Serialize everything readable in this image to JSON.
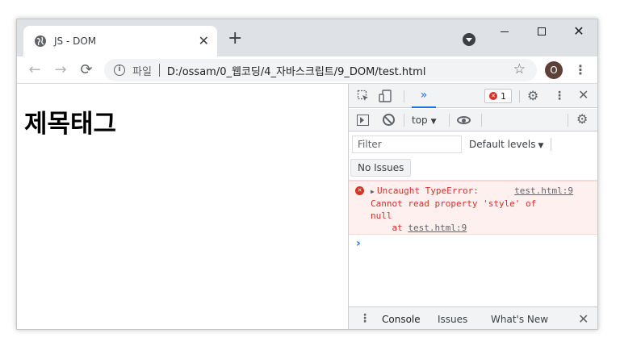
{
  "browser": {
    "tab_title": "JS - DOM",
    "tab_close": "✕",
    "new_tab": "+",
    "window_controls": {
      "close": "✕"
    },
    "nav": {
      "back": "←",
      "forward": "→",
      "reload": "⟳"
    },
    "address": {
      "info_glyph": "i",
      "scheme_label": "파일",
      "url": "D:/ossam/0_웹코딩/4_자바스크립트/9_DOM/test.html",
      "star": "☆"
    },
    "profile_initial": "O",
    "menu": "⋮"
  },
  "page": {
    "heading": "제목태그"
  },
  "devtools": {
    "top": {
      "more_tabs": "»",
      "error_count": "1",
      "error_glyph": "✕",
      "gear": "⚙",
      "kebab": "⋮",
      "close": "✕"
    },
    "console_bar": {
      "context": "top",
      "context_arrow": "▼",
      "gear": "⚙"
    },
    "filter": {
      "placeholder": "Filter",
      "levels": "Default levels",
      "levels_arrow": "▼"
    },
    "issues_button": "No Issues",
    "messages": [
      {
        "level": "error",
        "icon": "✕",
        "expander": "▶",
        "head": "Uncaught TypeError:",
        "source": "test.html:9",
        "line2": "Cannot read property 'style' of",
        "line3": "null",
        "at_prefix": "    at ",
        "at_link": "test.html:9"
      }
    ],
    "prompt": "›",
    "drawer": {
      "kebab": "⋮",
      "tabs": [
        "Console",
        "Issues",
        "What's New"
      ],
      "close": "✕"
    }
  },
  "colors": {
    "accent": "#1a73e8",
    "error": "#d93025",
    "error_bg": "#fff0f0",
    "avatar": "#5d4037"
  }
}
